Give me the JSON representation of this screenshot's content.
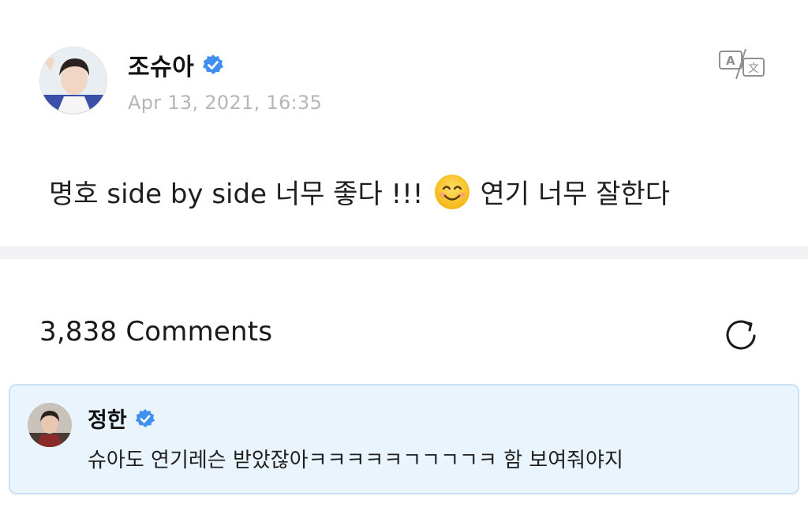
{
  "post": {
    "author": "조슈아",
    "timestamp": "Apr 13, 2021, 16:35",
    "text_before_emoji": "명호 side by side 너무 좋다 !!!",
    "text_after_emoji": "연기 너무 잘한다",
    "emoji": "smiling-face-icon"
  },
  "toolbar": {
    "translate_icon": "translate-icon"
  },
  "comments": {
    "count_label": "3,838 Comments",
    "refresh_icon": "refresh-icon",
    "items": [
      {
        "author": "정한",
        "text": "슈아도 연기레슨 받았잖아ㅋㅋㅋㅋㅋㄱㄱㄱㄱㅋ 함 보여줘야지"
      }
    ]
  },
  "colors": {
    "verified_blue": "#3f8ff0",
    "timestamp_gray": "#b4b6bb",
    "comment_bg": "#eaf4fc",
    "comment_border": "#c9e1f4",
    "divider": "#f2f2f5"
  }
}
